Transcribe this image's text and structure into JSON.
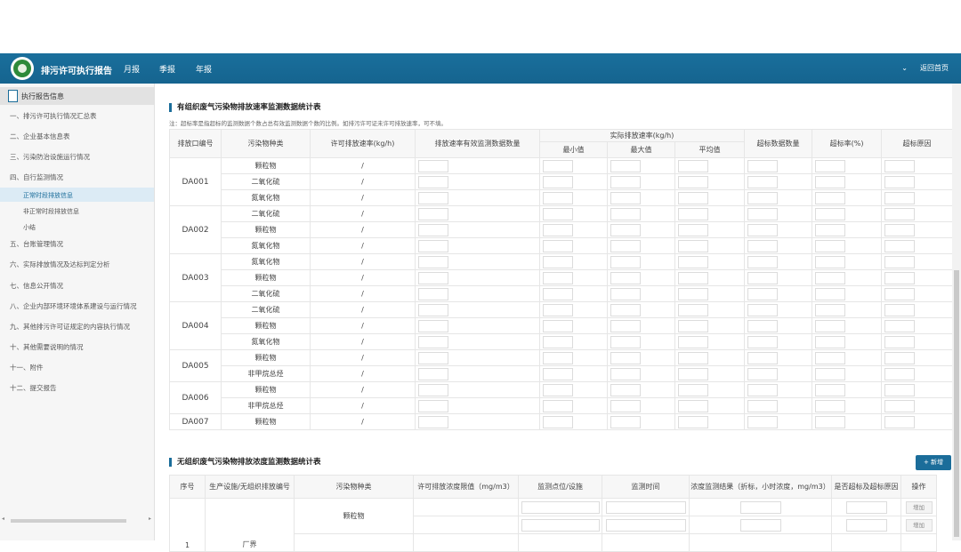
{
  "header": {
    "title": "排污许可执行报告",
    "nav": [
      "月报",
      "季报",
      "年报"
    ],
    "home_link": "返回首页"
  },
  "sidebar": {
    "head": "执行报告信息",
    "items": [
      "一、排污许可执行情况汇总表",
      "二、企业基本信息表",
      "三、污染防治设施运行情况",
      "四、自行监测情况",
      "五、台账管理情况",
      "六、实际排放情况及达标判定分析",
      "七、信息公开情况",
      "八、企业内部环境环境体系建设与运行情况",
      "九、其他排污许可证规定的内容执行情况",
      "十、其他需要说明的情况",
      "十一、附件",
      "十二、提交报告"
    ],
    "subitems": [
      "正常时段排放信息",
      "非正常时段排放信息",
      "小结"
    ]
  },
  "organized": {
    "title": "有组织废气污染物排放速率监测数据统计表",
    "note": "注：超标率是指超标的监测数据个数占总有效监测数据个数的比例。如排污许可证未许可排放速率，可不填。",
    "headers": {
      "outlet": "排放口编号",
      "pollutant": "污染物种类",
      "permit": "许可排放速率(kg/h)",
      "count": "排放速率有效监测数据数量",
      "actual": "实际排放速率(kg/h)",
      "min": "最小值",
      "max": "最大值",
      "avg": "平均值",
      "exceed_count": "超标数据数量",
      "exceed_rate": "超标率(%)",
      "exceed_reason": "超标原因"
    },
    "groups": [
      {
        "outlet": "DA001",
        "pollutants": [
          "颗粒物",
          "二氧化硫",
          "氮氧化物"
        ]
      },
      {
        "outlet": "DA002",
        "pollutants": [
          "二氧化硫",
          "颗粒物",
          "氮氧化物"
        ]
      },
      {
        "outlet": "DA003",
        "pollutants": [
          "氮氧化物",
          "颗粒物",
          "二氧化硫"
        ]
      },
      {
        "outlet": "DA004",
        "pollutants": [
          "二氧化硫",
          "颗粒物",
          "氮氧化物"
        ]
      },
      {
        "outlet": "DA005",
        "pollutants": [
          "颗粒物",
          "非甲烷总烃"
        ]
      },
      {
        "outlet": "DA006",
        "pollutants": [
          "颗粒物",
          "非甲烷总烃"
        ]
      },
      {
        "outlet": "DA007",
        "pollutants": [
          "颗粒物"
        ]
      }
    ],
    "permit_value": "/"
  },
  "unorganized": {
    "title": "无组织废气污染物排放浓度监测数据统计表",
    "add_button": "+ 新增",
    "headers": [
      "序号",
      "生产设施/无组织排放编号",
      "污染物种类",
      "许可排放浓度限值（mg/m3）",
      "监测点位/设施",
      "监测时间",
      "浓度监测结果（折标，小时浓度，mg/m3）",
      "是否超标及超标原因",
      "操作"
    ],
    "row": {
      "index": "1",
      "facility": "厂界",
      "pollutant": "颗粒物",
      "op": "增加"
    }
  }
}
